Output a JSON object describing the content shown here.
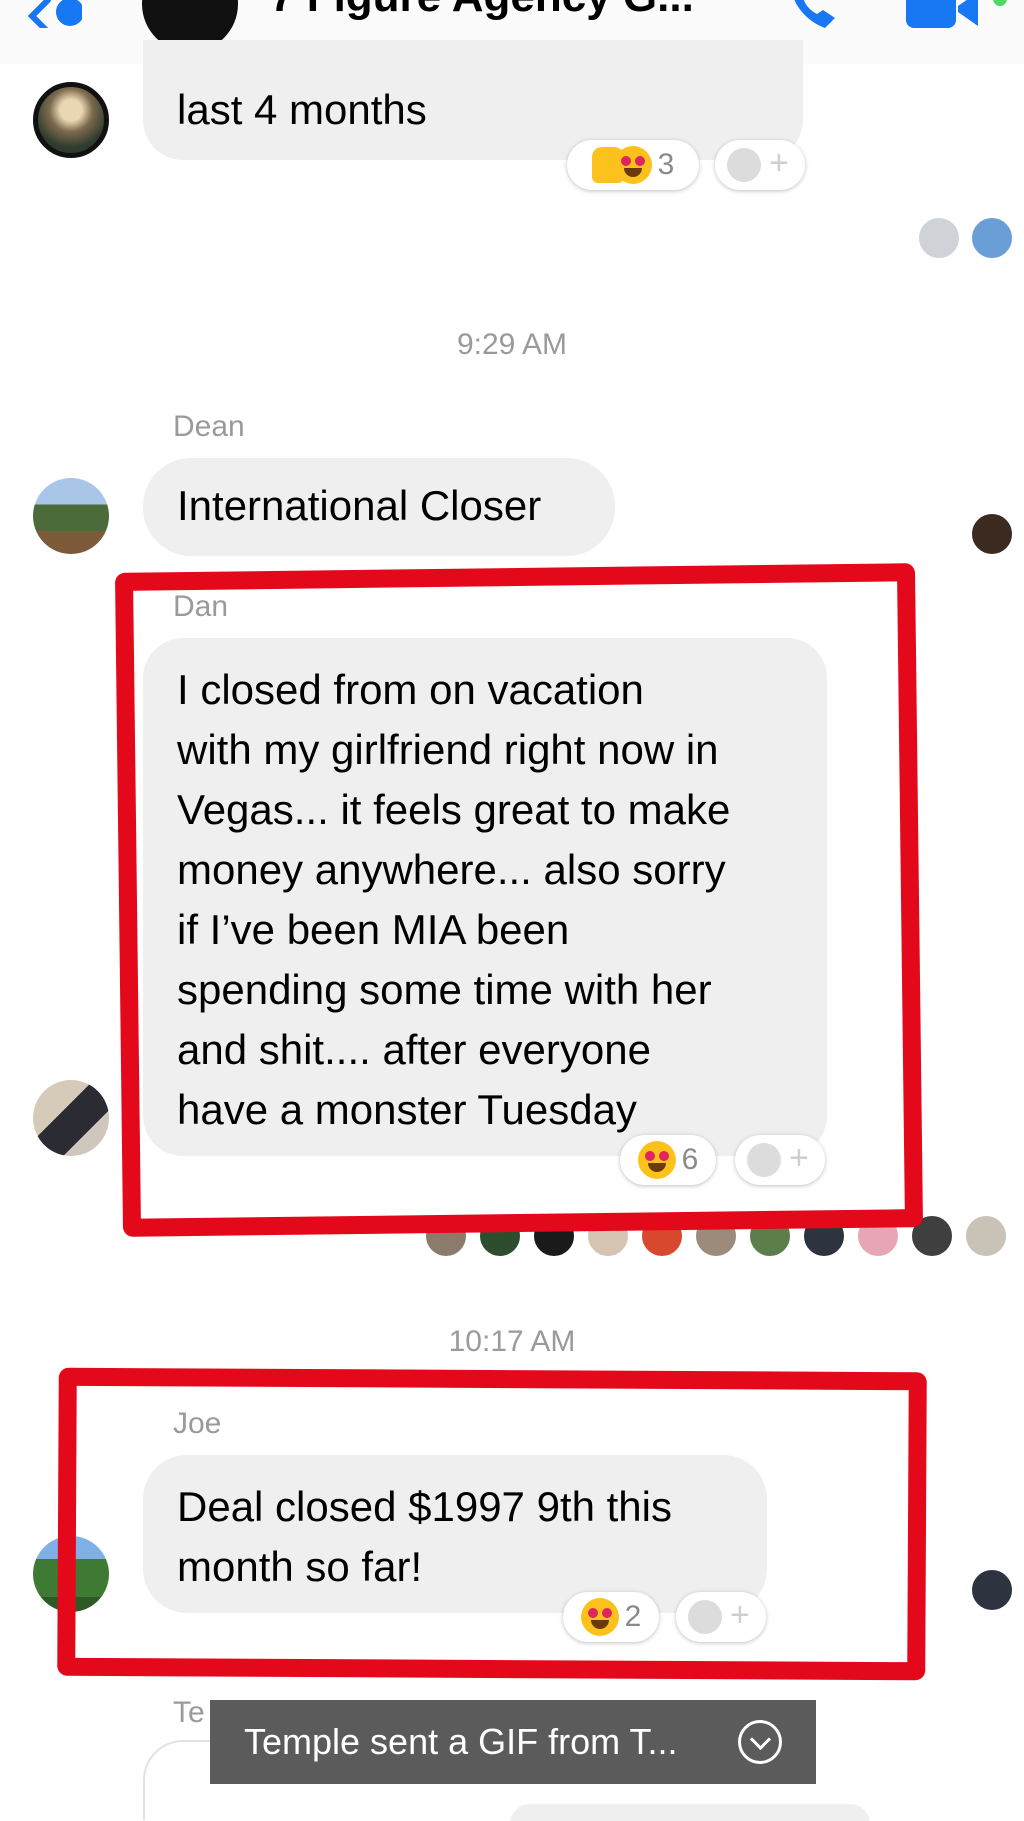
{
  "header": {
    "title": "7 Figure Agency G..."
  },
  "messages": [
    {
      "lines": [
        "last 4 months"
      ],
      "reactions": {
        "count": "3"
      }
    },
    {
      "timestamp": "9:29 AM",
      "sender": "Dean",
      "lines": [
        "International Closer"
      ]
    },
    {
      "sender": "Dan",
      "lines": [
        "I closed from on vacation",
        "with my girlfriend right now in",
        "Vegas... it feels great to make",
        "money anywhere... also sorry",
        "if I’ve been MIA been",
        "spending some time with her",
        "and shit.... after everyone",
        "have a monster Tuesday"
      ],
      "reactions": {
        "count": "6"
      }
    },
    {
      "timestamp": "10:17 AM",
      "sender": "Joe",
      "lines": [
        "Deal closed $1997 9th this",
        "month so far!"
      ],
      "reactions": {
        "count": "2"
      }
    },
    {
      "sender": "Te"
    }
  ],
  "banner": {
    "text": "Temple sent a GIF from T..."
  },
  "colors": {
    "accent": "#1877f2",
    "bubble": "#efefef",
    "annotation": "#e3091b",
    "banner": "#5b5b5b"
  }
}
